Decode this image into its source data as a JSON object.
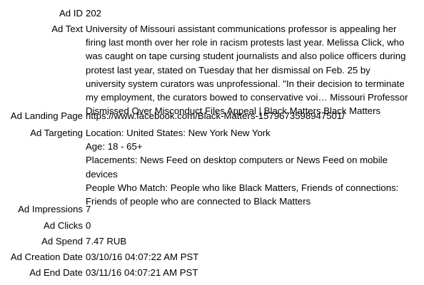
{
  "ad_id": {
    "label": "Ad ID",
    "value": "202"
  },
  "ad_text": {
    "label": "Ad Text",
    "lines": [
      "University of Missouri assistant communications professor is appealing her",
      "firing last month over her role in racism protests last year. Melissa Click, who",
      "was caught on tape cursing student journalists and also police officers during",
      "protest last year, stated on Tuesday that her dismissal on Feb. 25 by",
      "university system curators was unprofessional. \"In their decision to terminate",
      "my employment, the curators bowed to conservative voi… Missouri Professor",
      "Dismissed Over Misconduct Files Appeal | Black Matters Black Matters"
    ]
  },
  "ad_landing_page": {
    "label": "Ad Landing Page",
    "value": "https://www.facebook.com/Black-Matters-1579673598947501/"
  },
  "ad_targeting": {
    "label": "Ad Targeting",
    "lines": [
      "Location: United States: New York New York",
      "Age: 18 - 65+",
      "Placements: News Feed on desktop computers or News Feed on mobile",
      "devices",
      "People Who Match: People who like Black Matters, Friends of connections:",
      "Friends of people who are connected to Black Matters"
    ]
  },
  "ad_impressions": {
    "label": "Ad Impressions",
    "value": "7"
  },
  "ad_clicks": {
    "label": "Ad Clicks",
    "value": "0"
  },
  "ad_spend": {
    "label": "Ad Spend",
    "value": "7.47 RUB"
  },
  "ad_creation_date": {
    "label": "Ad Creation Date",
    "value": "03/10/16 04:07:22 AM PST"
  },
  "ad_end_date": {
    "label": "Ad End Date",
    "value": "03/11/16 04:07:21 AM PST"
  }
}
